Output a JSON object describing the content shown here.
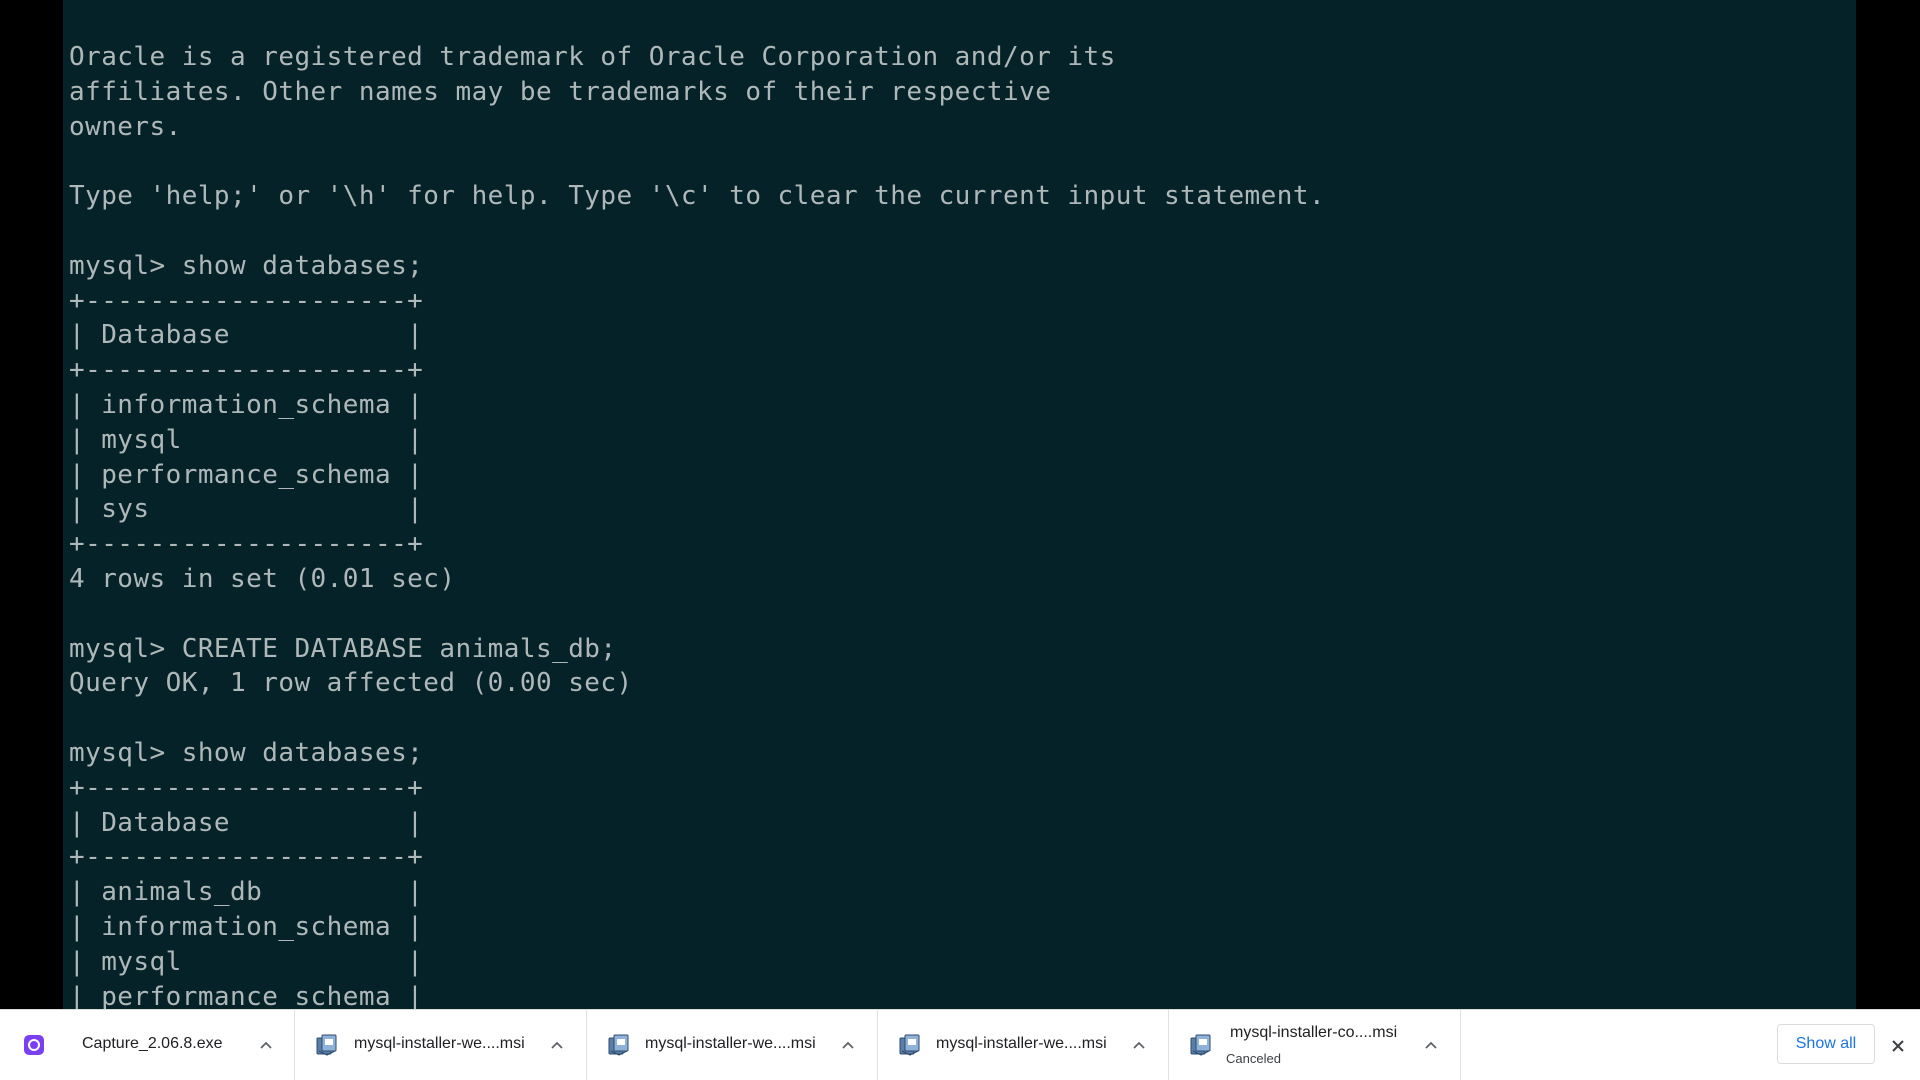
{
  "terminal": {
    "lines": [
      "Oracle is a registered trademark of Oracle Corporation and/or its",
      "affiliates. Other names may be trademarks of their respective",
      "owners.",
      "",
      "Type 'help;' or '\\h' for help. Type '\\c' to clear the current input statement.",
      "",
      "mysql> show databases;",
      "+--------------------+",
      "| Database           |",
      "+--------------------+",
      "| information_schema |",
      "| mysql              |",
      "| performance_schema |",
      "| sys                |",
      "+--------------------+",
      "4 rows in set (0.01 sec)",
      "",
      "mysql> CREATE DATABASE animals_db;",
      "Query OK, 1 row affected (0.00 sec)",
      "",
      "mysql> show databases;",
      "+--------------------+",
      "| Database           |",
      "+--------------------+",
      "| animals_db         |",
      "| information_schema |",
      "| mysql              |",
      "| performance_schema |"
    ]
  },
  "downloads": {
    "items": [
      {
        "name": "Capture_2.06.8.exe",
        "status": "",
        "icon": "app-icon-purple"
      },
      {
        "name": "mysql-installer-we....msi",
        "status": "",
        "icon": "msi-installer-icon"
      },
      {
        "name": "mysql-installer-we....msi",
        "status": "",
        "icon": "msi-installer-icon"
      },
      {
        "name": "mysql-installer-we....msi",
        "status": "",
        "icon": "msi-installer-icon"
      },
      {
        "name": "mysql-installer-co....msi",
        "status": "Canceled",
        "icon": "msi-installer-icon"
      }
    ],
    "show_all_label": "Show all"
  },
  "colors": {
    "terminal_bg": "#062229",
    "terminal_text": "#aeb8b9",
    "link_blue": "#1a73e8"
  }
}
